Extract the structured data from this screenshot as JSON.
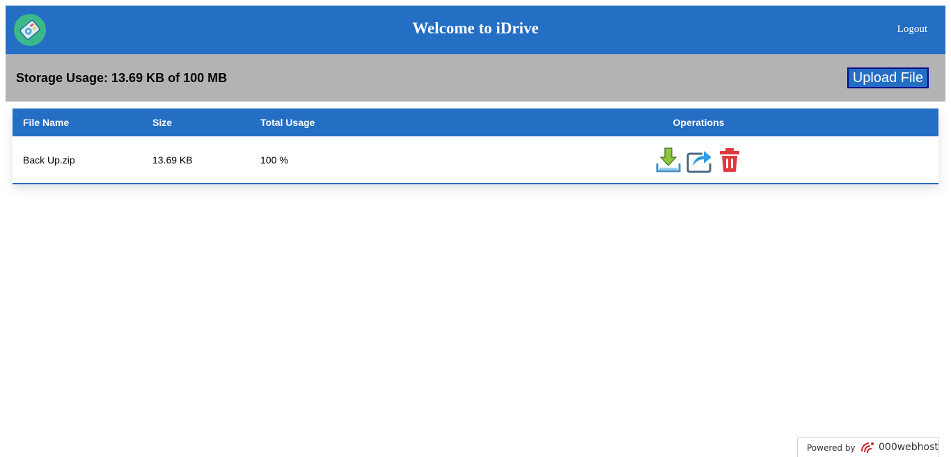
{
  "header": {
    "title": "Welcome to iDrive",
    "logout_label": "Logout",
    "logo_icon": "drive-logo-icon",
    "color": "#246ec4"
  },
  "usage": {
    "text": "Storage Usage: 13.69 KB of 100 MB",
    "upload_label": "Upload File"
  },
  "table": {
    "columns": [
      "File Name",
      "Size",
      "Total Usage",
      "Operations"
    ],
    "rows": [
      {
        "name": "Back Up.zip",
        "size": "13.69 KB",
        "usage": "100 %",
        "operations": [
          "download-icon",
          "share-icon",
          "delete-icon"
        ]
      }
    ]
  },
  "footer": {
    "powered_label": "Powered by",
    "brand": "000webhost",
    "brand_icon": "000webhost-logo-icon"
  }
}
